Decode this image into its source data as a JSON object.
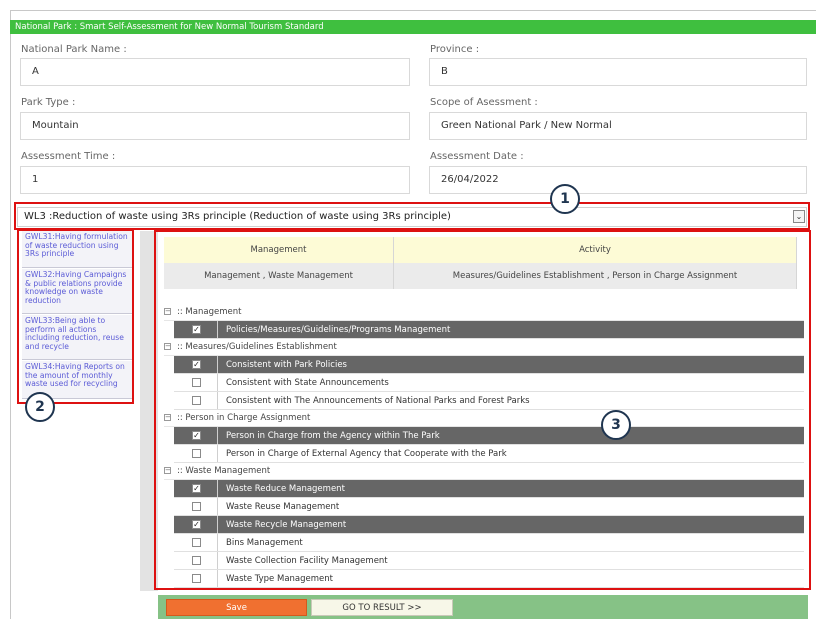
{
  "header": {
    "title": "National Park : Smart Self-Assessment for New Normal Tourism Standard"
  },
  "form": {
    "park_name": {
      "label": "National Park Name :",
      "value": "A"
    },
    "province": {
      "label": "Province :",
      "value": "B"
    },
    "park_type": {
      "label": "Park Type :",
      "value": "Mountain"
    },
    "scope": {
      "label": "Scope of Asessment :",
      "value": "Green National Park / New Normal"
    },
    "assessment_time": {
      "label": "Assessment Time :",
      "value": "1"
    },
    "assessment_date": {
      "label": "Assessment Date :",
      "value": "26/04/2022"
    }
  },
  "wl_select": {
    "value": "WL3 :Reduction of waste using 3Rs principle (Reduction of waste using 3Rs principle)",
    "arrow_icon": "chevron-down-icon"
  },
  "gwl_list": [
    "GWL31:Having formulation of waste reduction using 3Rs principle",
    "GWL32:Having Campaigns & public relations provide knowledge on waste reduction",
    "GWL33:Being able to perform all actions including reduction, reuse and recycle",
    "GWL34:Having Reports on the amount of monthly waste used for recycling"
  ],
  "table_header": {
    "col1": "Management",
    "col2": "Activity",
    "row_col1": "Management , Waste Management",
    "row_col2": "Measures/Guidelines Establishment , Person in Charge Assignment"
  },
  "tree": {
    "groups": [
      ":: Management",
      ":: Measures/Guidelines Establishment",
      ":: Person in Charge Assignment",
      ":: Waste Management"
    ],
    "items": [
      "Policies/Measures/Guidelines/Programs Management",
      "Consistent with Park Policies",
      "Consistent with State Announcements",
      "Consistent with The Announcements of National Parks and Forest Parks",
      "Person in Charge from the Agency within The Park",
      "Person in Charge of External Agency that Cooperate with the Park",
      "Waste Reduce Management",
      "Waste Reuse Management",
      "Waste Recycle Management",
      "Bins Management",
      "Waste Collection Facility Management",
      "Waste Type Management"
    ],
    "checked": [
      true,
      true,
      false,
      false,
      true,
      false,
      true,
      false,
      true,
      false,
      false,
      false
    ],
    "check_glyph": "☑",
    "expander_glyph": "−"
  },
  "callouts": [
    "1",
    "2",
    "3"
  ],
  "buttons": {
    "save": "Save",
    "result": "GO TO RESULT >>"
  },
  "colors": {
    "header_green": "#3fbf3f",
    "callout_red": "#dd1111",
    "selected_row": "#666666",
    "save_orange": "#f07030",
    "footer_green": "#86c286"
  }
}
